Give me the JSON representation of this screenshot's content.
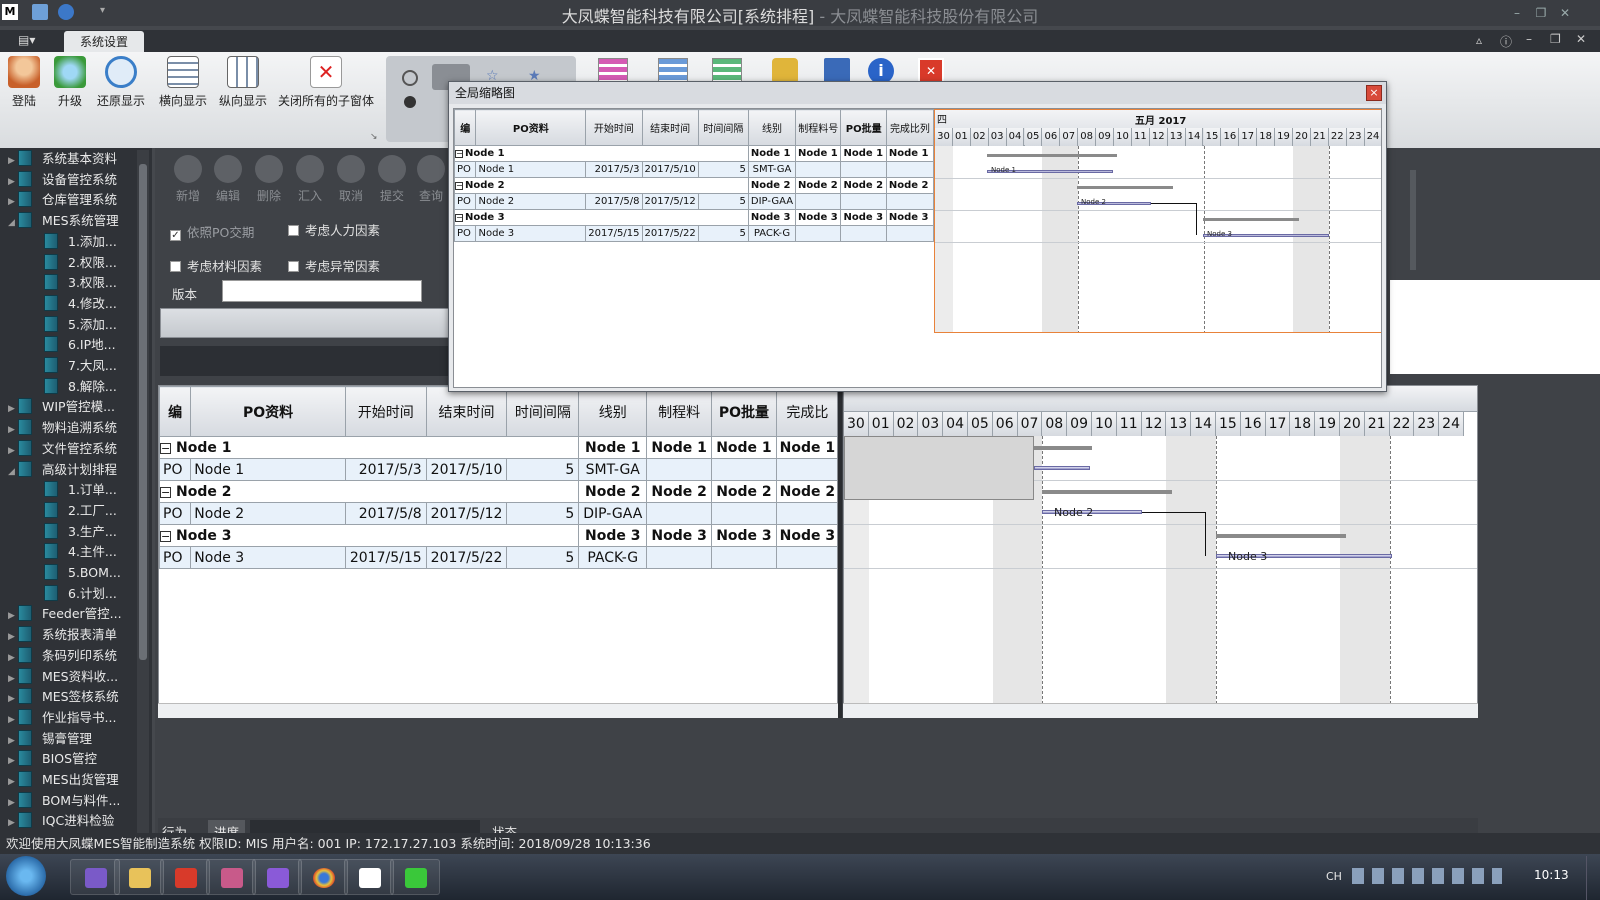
{
  "window": {
    "title": "大凤蝶智能科技有限公司[系统排程]",
    "title_suffix": " - 大凤蝶智能科技股份有限公司"
  },
  "menu": {
    "tab": "系统设置"
  },
  "ribbon": {
    "buttons": [
      "登陆",
      "升级",
      "还原显示",
      "横向显示",
      "纵向显示",
      "关闭所有的子窗体"
    ]
  },
  "sidebar": {
    "items": [
      {
        "label": "系统基本资料",
        "level": 0,
        "expanded": false
      },
      {
        "label": "设备管控系统",
        "level": 0,
        "expanded": false
      },
      {
        "label": "仓库管理系统",
        "level": 0,
        "expanded": false
      },
      {
        "label": "MES系统管理",
        "level": 0,
        "expanded": true
      },
      {
        "label": "1.添加...",
        "level": 1
      },
      {
        "label": "2.权限...",
        "level": 1
      },
      {
        "label": "3.权限...",
        "level": 1
      },
      {
        "label": "4.修改...",
        "level": 1
      },
      {
        "label": "5.添加...",
        "level": 1
      },
      {
        "label": "6.IP地...",
        "level": 1
      },
      {
        "label": "7.大凤...",
        "level": 1
      },
      {
        "label": "8.解除...",
        "level": 1
      },
      {
        "label": "WIP管控模...",
        "level": 0,
        "expanded": false
      },
      {
        "label": "物料追溯系统",
        "level": 0,
        "expanded": false
      },
      {
        "label": "文件管控系统",
        "level": 0,
        "expanded": false
      },
      {
        "label": "高级计划排程",
        "level": 0,
        "expanded": true
      },
      {
        "label": "1.订单...",
        "level": 1
      },
      {
        "label": "2.工厂...",
        "level": 1
      },
      {
        "label": "3.生产...",
        "level": 1
      },
      {
        "label": "4.主件...",
        "level": 1
      },
      {
        "label": "5.BOM...",
        "level": 1
      },
      {
        "label": "6.计划...",
        "level": 1
      },
      {
        "label": "Feeder管控...",
        "level": 0,
        "expanded": false
      },
      {
        "label": "系统报表清单",
        "level": 0,
        "expanded": false
      },
      {
        "label": "条码列印系统",
        "level": 0,
        "expanded": false
      },
      {
        "label": "MES资料收...",
        "level": 0,
        "expanded": false
      },
      {
        "label": "MES签核系统",
        "level": 0,
        "expanded": false
      },
      {
        "label": "作业指导书...",
        "level": 0,
        "expanded": false
      },
      {
        "label": "锡膏管理",
        "level": 0,
        "expanded": false
      },
      {
        "label": "BIOS管控",
        "level": 0,
        "expanded": false
      },
      {
        "label": "MES出货管理",
        "level": 0,
        "expanded": false
      },
      {
        "label": "BOM与料件...",
        "level": 0,
        "expanded": false
      },
      {
        "label": "IQC进料检验",
        "level": 0,
        "expanded": false
      }
    ]
  },
  "toolbar": {
    "buttons": [
      "新增",
      "编辑",
      "删除",
      "汇入",
      "取消",
      "提交",
      "查询"
    ]
  },
  "options": {
    "by_po_date": "依照PO交期",
    "consider_manpower": "考虑人力因素",
    "consider_material": "考虑材料因素",
    "consider_exception": "考虑异常因素",
    "version_label": "版本",
    "version_value": ""
  },
  "grid": {
    "columns": [
      "编",
      "PO资料",
      "开始时间",
      "结束时间",
      "时间间隔",
      "线别",
      "制程料",
      "PO批量",
      "完成比"
    ],
    "groups": [
      {
        "name": "Node 1",
        "cols": [
          "Node 1",
          "Node 1",
          "Node 1",
          "Node 1"
        ],
        "row": [
          "PO",
          "Node 1",
          "2017/5/3",
          "2017/5/10",
          "5",
          "SMT-GA",
          "",
          "",
          ""
        ]
      },
      {
        "name": "Node 2",
        "cols": [
          "Node 2",
          "Node 2",
          "Node 2",
          "Node 2"
        ],
        "row": [
          "PO",
          "Node 2",
          "2017/5/8",
          "2017/5/12",
          "5",
          "DIP-GAA",
          "",
          "",
          ""
        ]
      },
      {
        "name": "Node 3",
        "cols": [
          "Node 3",
          "Node 3",
          "Node 3",
          "Node 3"
        ],
        "row": [
          "PO",
          "Node 3",
          "2017/5/15",
          "2017/5/22",
          "5",
          "PACK-G",
          "",
          "",
          ""
        ]
      }
    ]
  },
  "gantt": {
    "days": [
      "30",
      "01",
      "02",
      "03",
      "04",
      "05",
      "06",
      "07",
      "08",
      "09",
      "10",
      "11",
      "12",
      "13",
      "14",
      "15",
      "16",
      "17",
      "18",
      "19",
      "20",
      "21",
      "22",
      "23",
      "24"
    ],
    "bar_labels": [
      "Node 2",
      "Node 3"
    ]
  },
  "bottom": {
    "tabs": [
      "行为",
      "进度"
    ],
    "status_label": "状态"
  },
  "dialog": {
    "title": "全局缩略图",
    "close": "×",
    "columns": [
      "编",
      "PO资料",
      "开始时间",
      "结束时间",
      "时间间隔",
      "线别",
      "制程料号",
      "PO批量",
      "完成比列"
    ],
    "week_label": "四",
    "month_label": "五月 2017",
    "bar_labels": [
      "Node 1",
      "Node 2",
      "Node 3"
    ]
  },
  "statusbar": {
    "text": "欢迎使用大凤蝶MES智能制造系统   权限ID: MIS   用户名: 001   IP: 172.17.27.103   系统时间: 2018/09/28 10:13:36"
  },
  "taskbar": {
    "tray_lang": "CH",
    "clock": "10:13"
  }
}
